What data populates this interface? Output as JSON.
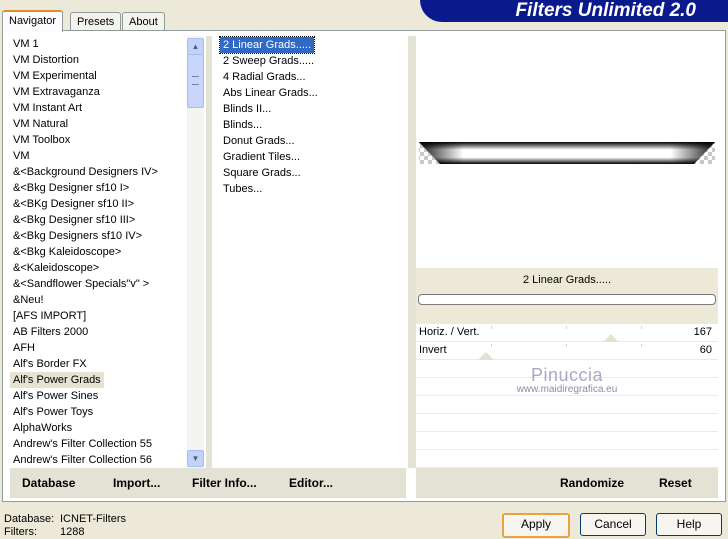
{
  "tabs": [
    "Navigator",
    "Presets",
    "About"
  ],
  "banner": "Filters Unlimited 2.0",
  "categories": [
    "VM 1",
    "VM Distortion",
    "VM Experimental",
    "VM Extravaganza",
    "VM Instant Art",
    "VM Natural",
    "VM Toolbox",
    "VM",
    "&<Background Designers IV>",
    "&<Bkg Designer sf10 I>",
    "&<BKg Designer sf10 II>",
    "&<Bkg Designer sf10 III>",
    "&<Bkg Designers sf10 IV>",
    "&<Bkg Kaleidoscope>",
    "&<Kaleidoscope>",
    "&<Sandflower Specials\"v\" >",
    "&Neu!",
    "[AFS IMPORT]",
    "AB Filters 2000",
    "AFH",
    "Alf's Border FX",
    "Alf's Power Grads",
    "Alf's Power Sines",
    "Alf's Power Toys",
    "AlphaWorks",
    "Andrew's Filter Collection 55",
    "Andrew's Filter Collection 56"
  ],
  "selected_category": "Alf's Power Grads",
  "filters": [
    "2 Linear Grads.....",
    "2 Sweep Grads.....",
    "4 Radial Grads...",
    "Abs Linear Grads...",
    "Blinds II...",
    "Blinds...",
    "Donut Grads...",
    "Gradient Tiles...",
    "Square Grads...",
    "Tubes..."
  ],
  "selected_filter": "2 Linear Grads.....",
  "filter_name": "2 Linear Grads.....",
  "controls": [
    {
      "label": "Horiz. / Vert.",
      "value": "167"
    },
    {
      "label": "Invert",
      "value": "60"
    }
  ],
  "watermark": {
    "name": "Pinuccia",
    "url": "www.maidiregrafica.eu"
  },
  "left_buttons": [
    "Database",
    "Import...",
    "Filter Info...",
    "Editor..."
  ],
  "right_buttons": [
    "Randomize",
    "Reset"
  ],
  "status": {
    "database_label": "Database:",
    "database_value": "ICNET-Filters",
    "filters_label": "Filters:",
    "filters_value": "1288"
  },
  "bottom_buttons": [
    "Apply",
    "Cancel",
    "Help"
  ],
  "icons": {
    "scroll_up": "▲",
    "scroll_down": "▼"
  }
}
